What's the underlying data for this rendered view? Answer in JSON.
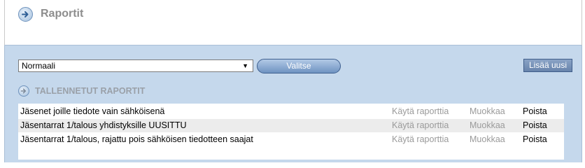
{
  "header": {
    "title": "Raportit",
    "icon": "arrow-right-circle-icon"
  },
  "toolbar": {
    "select_value": "Normaali",
    "select_arrow": "▼",
    "select_button_label": "Valitse",
    "add_button_label": "Lisää uusi"
  },
  "saved_reports": {
    "title": "TALLENNETUT RAPORTIT",
    "icon": "arrow-right-circle-icon",
    "rows": [
      {
        "name": "Jäsenet joille tiedote vain sähköisenä",
        "use": "Käytä raporttia",
        "edit": "Muokkaa",
        "delete": "Poista"
      },
      {
        "name": "Jäsentarrat 1/talous yhdistyksille UUSITTU",
        "use": "Käytä raporttia",
        "edit": "Muokkaa",
        "delete": "Poista"
      },
      {
        "name": "Jäsentarrat 1/talous, rajattu pois sähköisen tiedotteen saajat",
        "use": "Käytä raporttia",
        "edit": "Muokkaa",
        "delete": "Poista"
      }
    ]
  },
  "colors": {
    "panel": "#c5d8ec",
    "accent": "#6f93c1",
    "muted_text": "#9a9a9a"
  }
}
